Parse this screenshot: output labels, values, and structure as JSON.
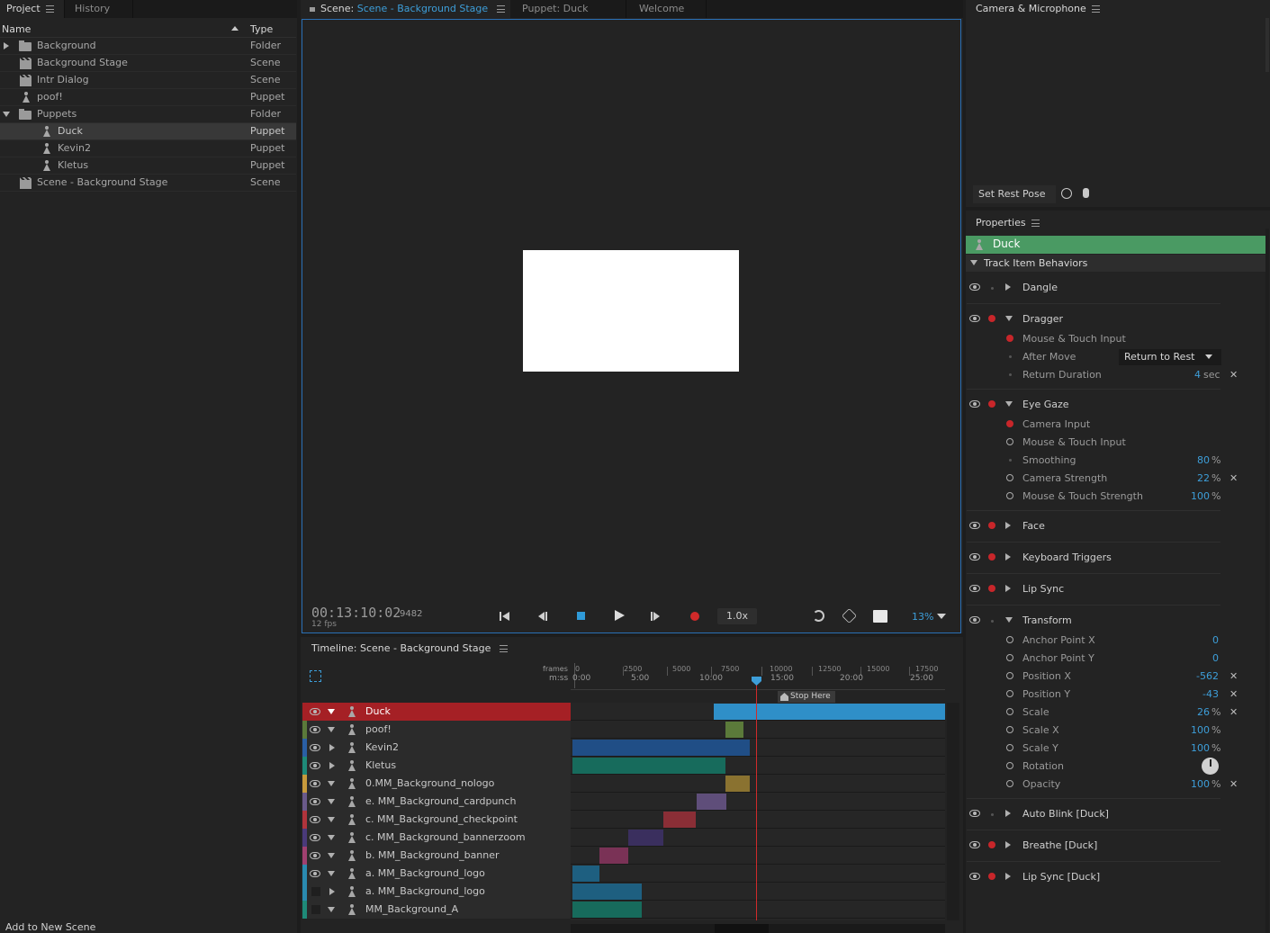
{
  "project": {
    "tabs": [
      "Project",
      "History"
    ],
    "col_name": "Name",
    "col_type": "Type",
    "rows": [
      {
        "name": "Background",
        "type": "Folder"
      },
      {
        "name": "Background Stage",
        "type": "Scene"
      },
      {
        "name": "Intr Dialog",
        "type": "Scene"
      },
      {
        "name": "poof!",
        "type": "Puppet"
      },
      {
        "name": "Puppets",
        "type": "Folder"
      },
      {
        "name": "Duck",
        "type": "Puppet"
      },
      {
        "name": "Kevin2",
        "type": "Puppet"
      },
      {
        "name": "Kletus",
        "type": "Puppet"
      },
      {
        "name": "Scene - Background Stage",
        "type": "Scene"
      }
    ],
    "add_to_scene": "Add to New Scene"
  },
  "scene_panel": {
    "tab_prefix": "Scene:",
    "tab_scene": "Scene - Background Stage",
    "tab_puppet": "Puppet: Duck",
    "tab_welcome": "Welcome",
    "timecode": "00:13:10:02",
    "frame": "9482",
    "fps": "12 fps",
    "speed": "1.0x",
    "zoom": "13%"
  },
  "camera": {
    "title": "Camera & Microphone",
    "set_rest_pose": "Set Rest Pose"
  },
  "timeline": {
    "title": "Timeline: Scene - Background Stage",
    "ruler_frames_label": "frames",
    "ruler_time_label": "m:ss",
    "frame_ticks": [
      "0",
      "2500",
      "5000",
      "7500",
      "10000",
      "12500",
      "15000",
      "17500"
    ],
    "time_ticks": [
      "0:00",
      "5:00",
      "10:00",
      "15:00",
      "20:00",
      "25:00"
    ],
    "marker": "Stop Here",
    "tracks": [
      {
        "name": "Duck",
        "color": "#a52025"
      },
      {
        "name": "poof!",
        "color": "#5b7a3a"
      },
      {
        "name": "Kevin2",
        "color": "#2a5fa5"
      },
      {
        "name": "Kletus",
        "color": "#1e8a78"
      },
      {
        "name": "0.MM_Background_nologo",
        "color": "#c79a3c"
      },
      {
        "name": "e. MM_Background_cardpunch",
        "color": "#6a5a8a"
      },
      {
        "name": "c. MM_Background_checkpoint",
        "color": "#b0343c"
      },
      {
        "name": "c. MM_Background_bannerzoom",
        "color": "#4a3a7a"
      },
      {
        "name": "b. MM_Background_banner",
        "color": "#a04070"
      },
      {
        "name": "a. MM_Background_logo",
        "color": "#2a8ab0"
      },
      {
        "name": "a. MM_Background_logo",
        "color": "#2a8ab0"
      },
      {
        "name": "MM_Background_A",
        "color": "#1e8a78"
      }
    ]
  },
  "properties": {
    "title": "Properties",
    "puppet": "Duck",
    "section": "Track Item Behaviors",
    "dangle": "Dangle",
    "dragger": {
      "label": "Dragger",
      "mouse_touch": "Mouse & Touch Input",
      "after_move": "After Move",
      "after_move_value": "Return to Rest",
      "return_duration": "Return Duration",
      "return_duration_value": "4",
      "return_duration_unit": "sec"
    },
    "eye_gaze": {
      "label": "Eye Gaze",
      "camera_input": "Camera Input",
      "mouse_touch": "Mouse & Touch Input",
      "smoothing": "Smoothing",
      "smoothing_value": "80",
      "camera_strength": "Camera Strength",
      "camera_strength_value": "22",
      "mt_strength": "Mouse & Touch Strength",
      "mt_strength_value": "100"
    },
    "face": "Face",
    "keyboard_triggers": "Keyboard Triggers",
    "lip_sync": "Lip Sync",
    "transform": {
      "label": "Transform",
      "anchor_x": "Anchor Point X",
      "anchor_x_value": "0",
      "anchor_y": "Anchor Point Y",
      "anchor_y_value": "0",
      "pos_x": "Position X",
      "pos_x_value": "-562",
      "pos_y": "Position Y",
      "pos_y_value": "-43",
      "scale": "Scale",
      "scale_value": "26",
      "scale_x": "Scale X",
      "scale_x_value": "100",
      "scale_y": "Scale Y",
      "scale_y_value": "100",
      "rotation": "Rotation",
      "opacity": "Opacity",
      "opacity_value": "100"
    },
    "percent": "%",
    "auto_blink": "Auto Blink [Duck]",
    "breathe": "Breathe [Duck]",
    "lip_sync_duck": "Lip Sync [Duck]"
  }
}
